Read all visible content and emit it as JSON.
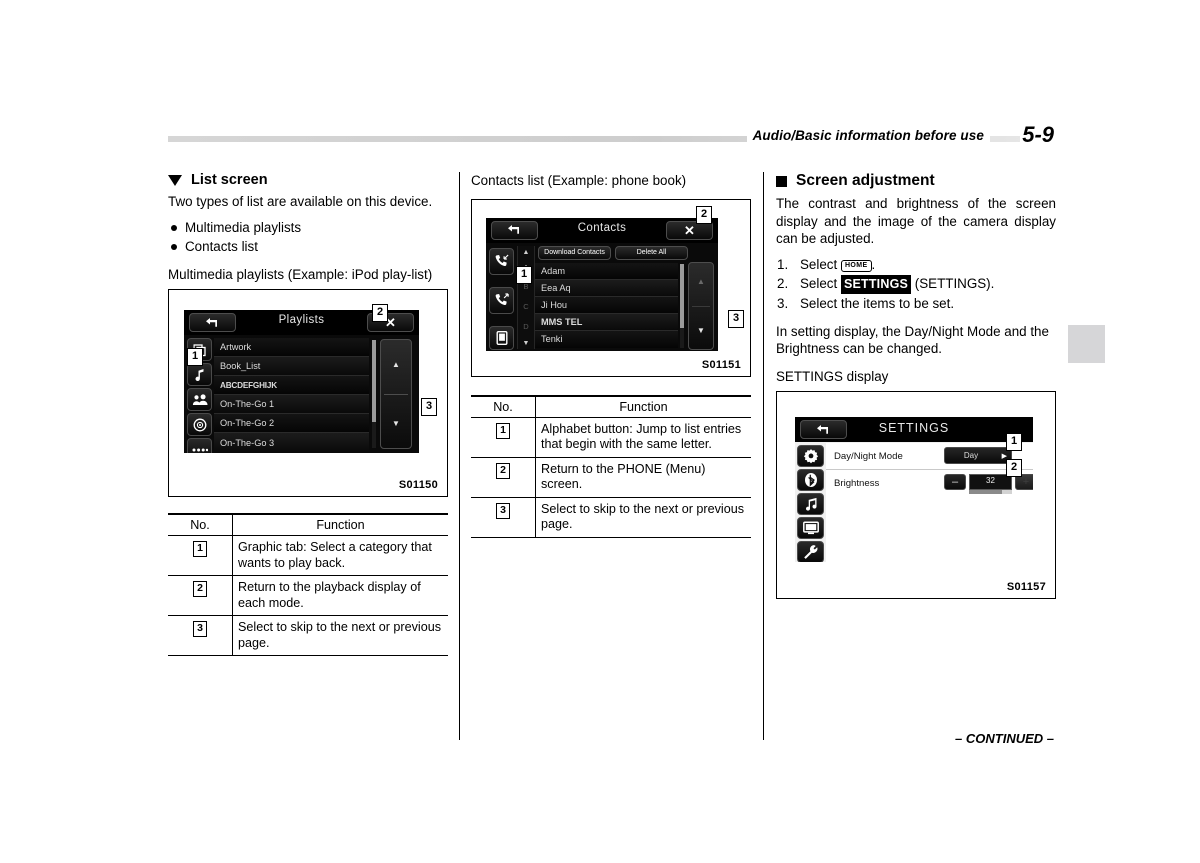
{
  "header": {
    "title": "Audio/Basic information before use",
    "page": "5-9"
  },
  "footer": {
    "continued": "– CONTINUED –"
  },
  "column_left": {
    "section_heading": "List screen",
    "intro": "Two types of list are available on this device.",
    "bullets": [
      "Multimedia playlists",
      "Contacts list"
    ],
    "figure_caption": "Multimedia playlists (Example: iPod play-list)",
    "figure_code": "S01150",
    "playlist_screen": {
      "title": "Playlists",
      "back_icon": "back-arrow-icon",
      "close_icon": "close-x-icon",
      "tab_icons": [
        "artwork-icon",
        "music-note-icon",
        "artist-icon",
        "album-disc-icon",
        "more-dots-icon"
      ],
      "items": [
        "Artwork",
        "Book_List",
        "ABCDEFGHIJK",
        "On-The-Go 1",
        "On-The-Go 2",
        "On-The-Go 3"
      ],
      "markers": [
        "1",
        "2",
        "3"
      ]
    },
    "table": {
      "headers": [
        "No.",
        "Function"
      ],
      "rows": [
        {
          "no": "1",
          "function": "Graphic tab: Select a category that wants to play back."
        },
        {
          "no": "2",
          "function": "Return to the playback display of each mode."
        },
        {
          "no": "3",
          "function": "Select to skip to the next or previous page."
        }
      ]
    }
  },
  "column_middle": {
    "figure_caption": "Contacts list (Example: phone book)",
    "figure_code": "S01151",
    "contacts_screen": {
      "title": "Contacts",
      "back_icon": "back-arrow-icon",
      "close_icon": "close-x-icon",
      "side_icons": [
        "incoming-call-icon",
        "outgoing-call-icon",
        "phone-device-icon"
      ],
      "action_buttons": [
        "Download Contacts",
        "Delete All"
      ],
      "alphabet": [
        "▲",
        "A",
        "B",
        "C",
        "D",
        "▼"
      ],
      "items": [
        "Adam",
        "Eea Aq",
        "Ji Hou",
        "MMS TEL",
        "Tenki"
      ],
      "markers": [
        "1",
        "2",
        "3"
      ]
    },
    "table": {
      "headers": [
        "No.",
        "Function"
      ],
      "rows": [
        {
          "no": "1",
          "function": "Alphabet button: Jump to list entries that begin with the same letter."
        },
        {
          "no": "2",
          "function": "Return to the PHONE (Menu) screen."
        },
        {
          "no": "3",
          "function": "Select to skip to the next or previous page."
        }
      ]
    }
  },
  "column_right": {
    "section_heading": "Screen adjustment",
    "intro": "The contrast and brightness of the screen display and the image of the camera display can be adjusted.",
    "steps": [
      {
        "prefix": "Select ",
        "key": "HOME",
        "suffix": "."
      },
      {
        "prefix": "Select ",
        "inverse_key": "SETTINGS",
        "suffix": " (SETTINGS)."
      },
      {
        "plain": "Select the items to be set."
      }
    ],
    "note": "In setting display, the Day/Night Mode and the Brightness can be changed.",
    "figure_caption": "SETTINGS display",
    "figure_code": "S01157",
    "settings_screen": {
      "title": "SETTINGS",
      "back_icon": "back-arrow-icon",
      "side_icons": [
        "gear-icon",
        "bluetooth-icon",
        "music-notes-icon",
        "display-icon",
        "wrench-icon"
      ],
      "rows": [
        {
          "label": "Day/Night Mode",
          "value": "Day",
          "control": "chevron-right",
          "marker": "1"
        },
        {
          "label": "Brightness",
          "value": "32",
          "minus": "–",
          "plus": "+",
          "control": "stepper",
          "marker": "2"
        }
      ]
    }
  }
}
